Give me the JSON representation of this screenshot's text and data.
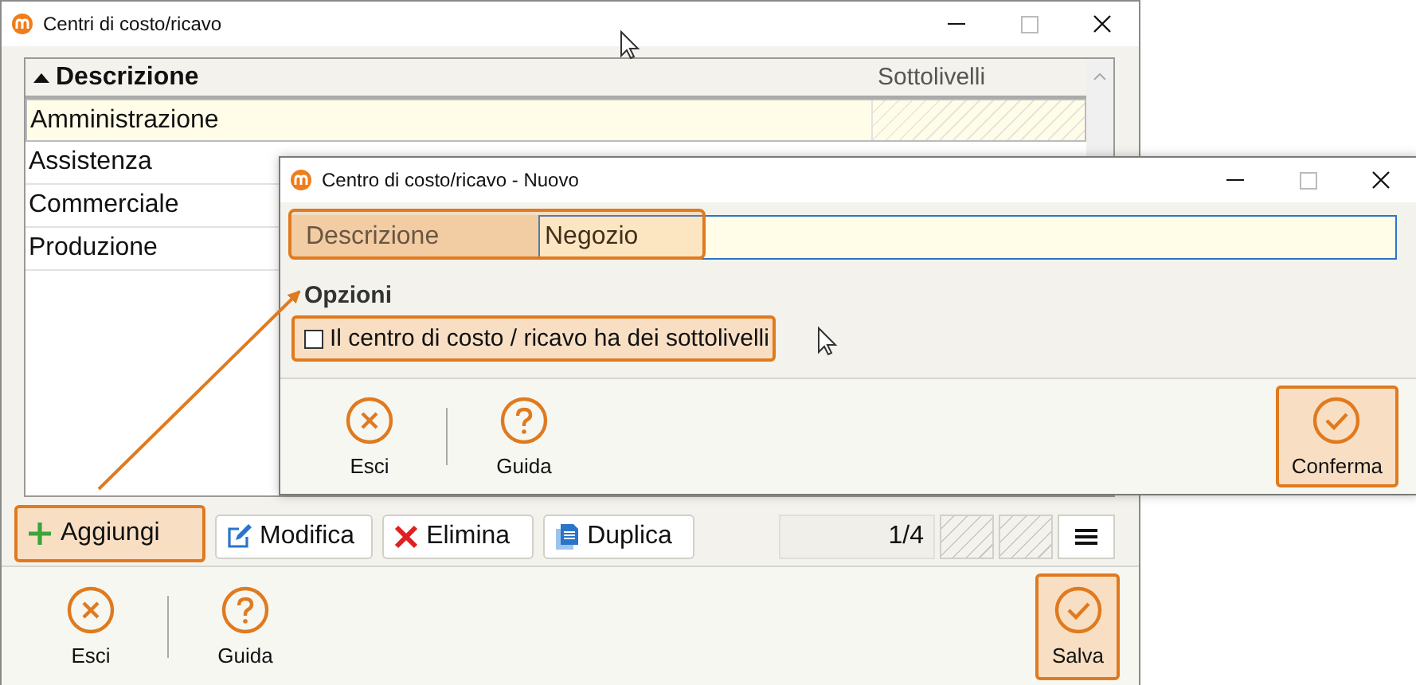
{
  "main_window": {
    "title": "Centri di costo/ricavo",
    "table": {
      "columns": [
        {
          "label": "Descrizione",
          "sorted": true
        },
        {
          "label": "Sottolivelli",
          "sorted": false
        }
      ],
      "rows": [
        {
          "label": "Amministrazione",
          "selected": true
        },
        {
          "label": "Assistenza",
          "selected": false
        },
        {
          "label": "Commerciale",
          "selected": false
        },
        {
          "label": "Produzione",
          "selected": false
        }
      ]
    },
    "toolbar": [
      {
        "label": "Aggiungi",
        "kind": "add",
        "highlighted": true
      },
      {
        "label": "Modifica",
        "kind": "edit",
        "highlighted": false
      },
      {
        "label": "Elimina",
        "kind": "delete",
        "highlighted": false
      },
      {
        "label": "Duplica",
        "kind": "duplicate",
        "highlighted": false
      }
    ],
    "pager": "1/4",
    "footer": [
      {
        "label": "Esci",
        "kind": "exit"
      },
      {
        "label": "Guida",
        "kind": "help"
      }
    ],
    "confirm": {
      "label": "Salva",
      "highlighted": true
    }
  },
  "dialog": {
    "title": "Centro di costo/ricavo - Nuovo",
    "field": {
      "label": "Descrizione",
      "value": "Negozio",
      "highlighted": true
    },
    "section": "Opzioni",
    "checkbox": {
      "label": "Il centro di costo / ricavo ha dei sottolivelli",
      "checked": false,
      "highlighted": true
    },
    "footer": [
      {
        "label": "Esci",
        "kind": "exit"
      },
      {
        "label": "Guida",
        "kind": "help"
      }
    ],
    "confirm": {
      "label": "Conferma",
      "highlighted": true
    }
  }
}
